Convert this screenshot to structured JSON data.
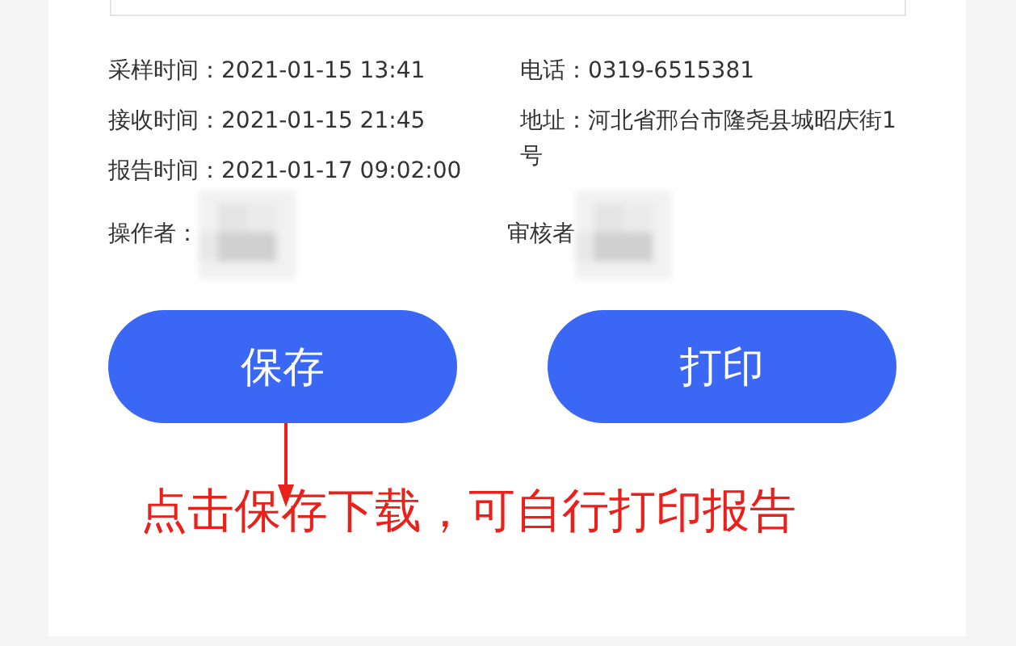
{
  "info_left": [
    {
      "label": "采样时间：",
      "value": "2021-01-15 13:41"
    },
    {
      "label": "接收时间：",
      "value": "2021-01-15 21:45"
    },
    {
      "label": "报告时间：",
      "value": "2021-01-17 09:02:00"
    }
  ],
  "info_right": [
    {
      "label": "电话：",
      "value": "0319-6515381"
    },
    {
      "label": "地址：",
      "value": "河北省邢台市隆尧县城昭庆街1号"
    }
  ],
  "signatures": [
    {
      "label": "操作者："
    },
    {
      "label": "审核者"
    }
  ],
  "buttons": [
    {
      "label": "保存"
    },
    {
      "label": "打印"
    }
  ],
  "annotation": "点击保存下载，可自行打印报告"
}
